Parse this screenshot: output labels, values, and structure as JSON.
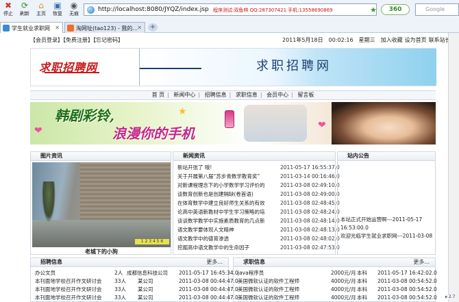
{
  "browser": {
    "toolbar": [
      {
        "label": "停止",
        "icon": "close-icon"
      },
      {
        "label": "刷新",
        "icon": "refresh-icon"
      },
      {
        "label": "主页",
        "icon": "home-icon"
      },
      {
        "label": "恢复",
        "icon": "restore-icon"
      },
      {
        "label": "无痕",
        "icon": "incognito-icon"
      }
    ],
    "address": "http://localhost:8080/JYQZ/index.jsp",
    "address_promo": "程序测试:双鱼林  QQ:287307421  手机:13558690869",
    "security_badge": "360",
    "search_placeholder": "Google",
    "tabs": [
      {
        "label": "学生就业求职网"
      },
      {
        "label": "淘网址(tao123) - 我的..."
      }
    ],
    "new_tab": "+",
    "zoom": "▸ 2.7"
  },
  "header": {
    "top_links": "【会员登录】【免费注册】【忘记密码】",
    "date": "2011年5月18日",
    "time": "00:02:16",
    "weekday": "星期三",
    "favorites": "加入收藏",
    "set_home": "设为首页",
    "contact": "联系站长",
    "logo": "求职招聘网",
    "banner_title": "求职招聘网"
  },
  "nav": [
    "首 页",
    "新闻中心",
    "招聘信息",
    "求职信息",
    "会员中心",
    "留言板"
  ],
  "promo": {
    "line1": "韩剧彩铃,",
    "line2": "浪漫你的手机"
  },
  "photo_panel": {
    "title": "图片资讯",
    "caption": "老城下的小狗",
    "pager": "1 2 3 4 5 6"
  },
  "news_panel": {
    "title": "新闻资讯",
    "items": [
      {
        "title": "新站开张了 哦!",
        "date": "2011-05-17 16:55:37.0"
      },
      {
        "title": "关于开展第八届“苏步青数学教育奖”",
        "date": "2011-03-14 00:16:46.0"
      },
      {
        "title": "对新课程理念下的小学数学学习评价的",
        "date": "2011-03-08 02:49:10.0"
      },
      {
        "title": "谈数育创新也是创建隔缺(卷首语)",
        "date": "2011-03-08 02:49:00.0"
      },
      {
        "title": "在体育数学中建立良好师生关系的有效",
        "date": "2011-03-08 02:48:45.0"
      },
      {
        "title": "论高中英语新教材中学生学习策略的培",
        "date": "2011-03-08 02:48:24.0"
      },
      {
        "title": "谈谈数学教学中实施素质教育的几点新",
        "date": "2011-03-08 02:48:14.0"
      },
      {
        "title": "语文教学要体现人文精神",
        "date": "2011-03-08 02:48:13.0"
      },
      {
        "title": "语文教学中的德育渗透",
        "date": "2011-03-08 02:48:02.0"
      },
      {
        "title": "挖掘高中语文教学中的生命因子",
        "date": "2011-03-08 02:47:53.0"
      }
    ]
  },
  "notice_panel": {
    "title": "站内公告",
    "lines": [
      "本站正式开始运营啊---2011-05-17",
      "16:53:00.0",
      "欢迎光临学生就业求职网---2011-03-08"
    ]
  },
  "jobs_panel": {
    "title": "招聘信息",
    "more": "更多...",
    "rows": [
      {
        "job": "办公文员",
        "num": "2人",
        "company": "成都信息科技公司",
        "date": "2011-05-17 16:45:34.0"
      },
      {
        "job": "本刊面地学校召开作文研讨会",
        "num": "33人",
        "company": "某公司",
        "date": "2011-03-08 00:44:47.0"
      },
      {
        "job": "本刊面地学校召开作文研讨会",
        "num": "33人",
        "company": "某公司",
        "date": "2011-03-08 00:44:47.0"
      },
      {
        "job": "本刊面地学校召开作文研讨会",
        "num": "33人",
        "company": "某公司",
        "date": "2011-03-08 00:44:47.0"
      }
    ]
  },
  "seek_panel": {
    "title": "求职信息",
    "more": "更多...",
    "rows": [
      {
        "job": "java程序员",
        "salary": "2000元/月",
        "edu": "本科",
        "date": "2011-05-17 16:42:02.0"
      },
      {
        "job": "美国微软认证的软件工程师",
        "salary": "4000元/月",
        "edu": "本科",
        "date": "2011-03-08 00:54:52.0"
      },
      {
        "job": "美国微软认证的软件工程师",
        "salary": "4000元/月",
        "edu": "本科",
        "date": "2011-03-08 00:54:52.0"
      },
      {
        "job": "美国微软认证的软件工程师",
        "salary": "4000元/月",
        "edu": "本科",
        "date": "2011-03-08 00:54:52.0"
      }
    ]
  }
}
